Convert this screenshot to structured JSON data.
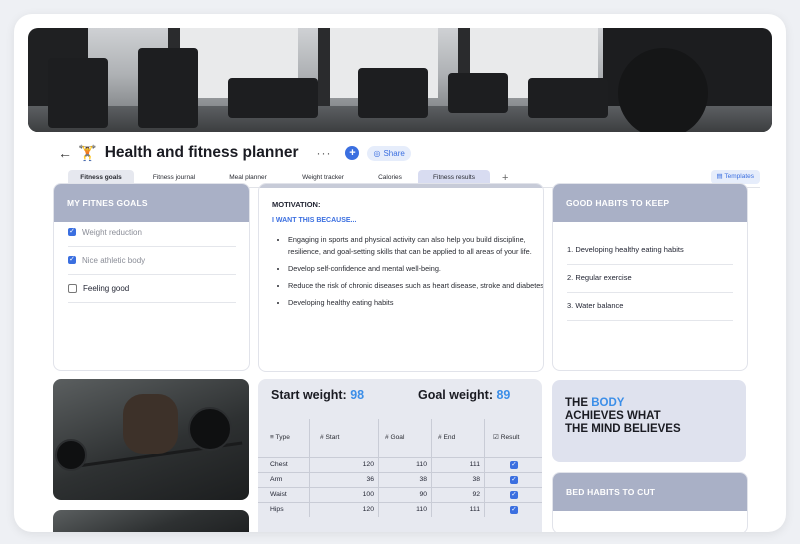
{
  "header": {
    "title": "Health and fitness planner",
    "title_emoji": "🏋",
    "more_label": "···",
    "add_label": "+",
    "share_label": "Share"
  },
  "tabs": [
    {
      "label": "Fitness goals"
    },
    {
      "label": "Fitness journal"
    },
    {
      "label": "Meal planner"
    },
    {
      "label": "Weight tracker"
    },
    {
      "label": "Calories"
    },
    {
      "label": "Fitness results"
    }
  ],
  "add_tab_label": "+",
  "templates_label": "Templates",
  "goals": {
    "title": "MY FITNES GOALS",
    "items": [
      {
        "label": "Weight reduction",
        "checked": true
      },
      {
        "label": "Nice athletic body",
        "checked": true
      },
      {
        "label": "Feeling good",
        "checked": false
      }
    ]
  },
  "motivation": {
    "title": "MOTIVATION:",
    "subtitle": "I WANT THIS BECAUSE...",
    "items": [
      "Engaging in sports and physical activity can also help you build discipline, resilience, and goal-setting skills that can be applied to all areas of your life.",
      "Develop self-confidence and mental well-being.",
      "Reduce the risk of chronic diseases such as heart disease, stroke and diabetes.",
      "Developing healthy eating habits"
    ]
  },
  "habits": {
    "title": "GOOD HABITS TO KEEP",
    "items": [
      "1.  Developing healthy eating habits",
      "2.  Regular exercise",
      "3.  Water balance"
    ]
  },
  "weights": {
    "start_label": "Start weight:",
    "start_value": "98",
    "goal_label": "Goal weight:",
    "goal_value": "89",
    "columns": [
      "≡ Type",
      "# Start",
      "# Goal",
      "# End",
      "☑ Result"
    ],
    "rows": [
      {
        "type": "Chest",
        "start": "120",
        "goal": "110",
        "end": "111",
        "result": true
      },
      {
        "type": "Arm",
        "start": "36",
        "goal": "38",
        "end": "38",
        "result": true
      },
      {
        "type": "Waist",
        "start": "100",
        "goal": "90",
        "end": "92",
        "result": true
      },
      {
        "type": "Hips",
        "start": "120",
        "goal": "110",
        "end": "111",
        "result": true
      }
    ]
  },
  "quote": {
    "line1_a": "THE ",
    "line1_b": "BODY",
    "line2": "ACHIEVES WHAT",
    "line3": "THE MIND BELIEVES"
  },
  "bad_habits": {
    "title": "BED HABITS TO CUT"
  },
  "colors": {
    "accent": "#3b6fe0",
    "card_header": "#a9b0c6",
    "highlight_blue": "#3b8ee8"
  }
}
